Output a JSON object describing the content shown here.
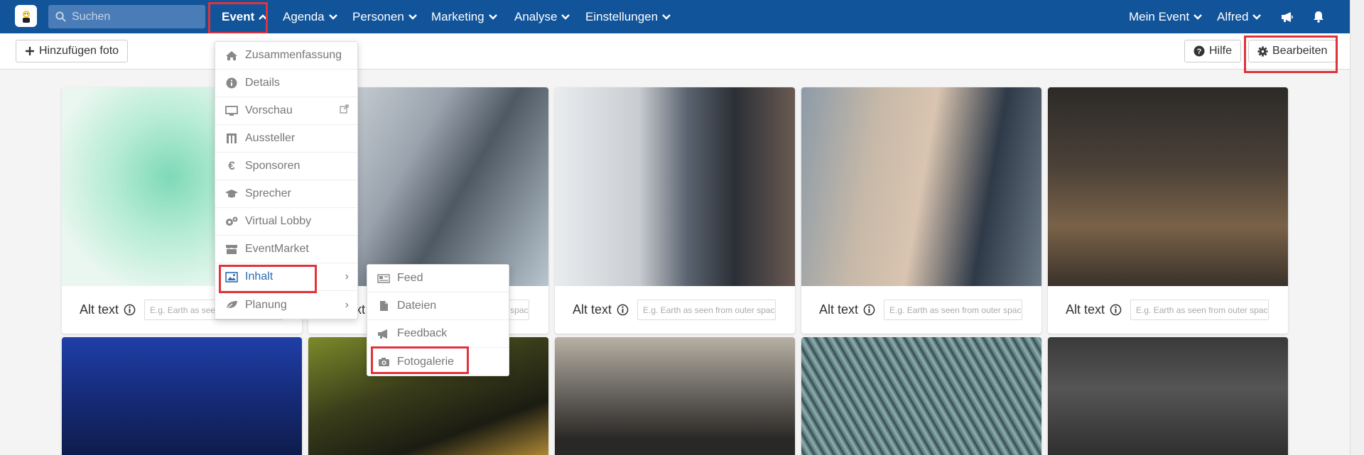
{
  "nav": {
    "search_placeholder": "Suchen",
    "items": [
      {
        "label": "Event"
      },
      {
        "label": "Agenda"
      },
      {
        "label": "Personen"
      },
      {
        "label": "Marketing"
      },
      {
        "label": "Analyse"
      },
      {
        "label": "Einstellungen"
      }
    ],
    "right_items": [
      {
        "label": "Mein Event"
      },
      {
        "label": "Alfred"
      }
    ]
  },
  "toolbar": {
    "add_photo_label": "Hinzufügen foto",
    "help_label": "Hilfe",
    "edit_label": "Bearbeiten"
  },
  "event_menu": {
    "items": [
      {
        "label": "Zusammenfassung",
        "icon": "home-icon"
      },
      {
        "label": "Details",
        "icon": "info-icon"
      },
      {
        "label": "Vorschau",
        "icon": "monitor-icon"
      },
      {
        "label": "Aussteller",
        "icon": "booth-icon"
      },
      {
        "label": "Sponsoren",
        "icon": "euro-icon"
      },
      {
        "label": "Sprecher",
        "icon": "graduation-cap-icon"
      },
      {
        "label": "Virtual Lobby",
        "icon": "gears-icon"
      },
      {
        "label": "EventMarket",
        "icon": "store-icon"
      },
      {
        "label": "Inhalt",
        "icon": "image-icon"
      },
      {
        "label": "Planung",
        "icon": "leaf-icon"
      }
    ]
  },
  "content_submenu": {
    "items": [
      {
        "label": "Feed",
        "icon": "newspaper-icon"
      },
      {
        "label": "Dateien",
        "icon": "file-icon"
      },
      {
        "label": "Feedback",
        "icon": "megaphone-icon"
      },
      {
        "label": "Fotogalerie",
        "icon": "camera-icon"
      }
    ]
  },
  "gallery": {
    "alt_label": "Alt text",
    "alt_placeholder": "E.g. Earth as seen from outer space"
  },
  "colors": {
    "nav_bg": "#11549a",
    "highlight": "#e0333a",
    "active_menu": "#2b6cb0"
  }
}
